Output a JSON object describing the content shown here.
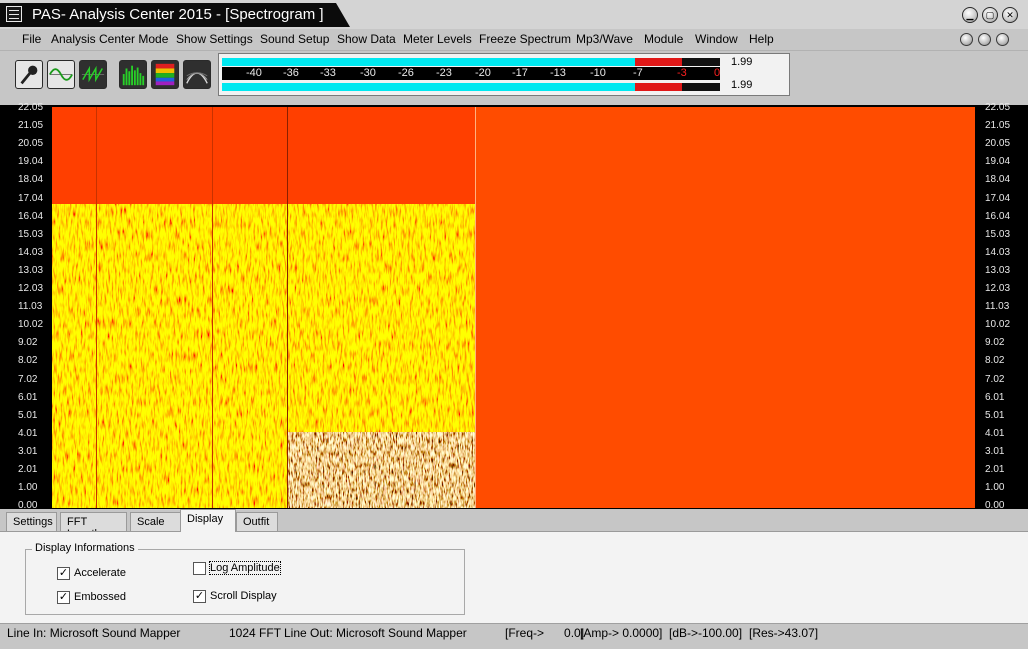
{
  "window": {
    "title": "PAS- Analysis Center 2015 - [Spectrogram ]",
    "icon": "app-window-icon"
  },
  "menu": [
    "File",
    "Analysis Center Mode",
    "Show Settings",
    "Sound Setup",
    "Show Data",
    "Meter Levels",
    "Freeze Spectrum",
    "Mp3/Wave",
    "Module",
    "Window",
    "Help"
  ],
  "toolbar": {
    "buttons": [
      "microphone-icon",
      "sine-wave-icon",
      "sawtooth-wave-icon",
      "spectrum-bars-icon",
      "spectrogram-icon",
      "waterfall-icon"
    ]
  },
  "meter": {
    "scale": [
      "-40",
      "-36",
      "-33",
      "-30",
      "-26",
      "-23",
      "-20",
      "-17",
      "-13",
      "-10",
      "-7",
      "-3",
      "0"
    ],
    "peaks": [
      "1.99",
      "1.99"
    ],
    "colors": {
      "level": "#00e8f0",
      "hot": "#e01818",
      "red_ticks": [
        "-3",
        "0"
      ]
    }
  },
  "spectrogram": {
    "y_axis_labels": [
      "22.05",
      "21.05",
      "20.05",
      "19.04",
      "18.04",
      "17.04",
      "16.04",
      "15.03",
      "14.03",
      "13.03",
      "12.03",
      "11.03",
      "10.02",
      "9.02",
      "8.02",
      "7.02",
      "6.01",
      "5.01",
      "4.01",
      "3.01",
      "2.01",
      "1.00",
      "0.00"
    ],
    "colors": {
      "background": "#ff4c00",
      "texture_hi": "#ffd200",
      "texture_lo": "#c83200"
    }
  },
  "tabs": {
    "items": [
      "Settings",
      "FFT Length",
      "Scale",
      "Display",
      "Outfit"
    ],
    "active": "Display"
  },
  "display_panel": {
    "group_title": "Display Informations",
    "options": {
      "accelerate": {
        "label": "Accelerate",
        "checked": true
      },
      "embossed": {
        "label": "Embossed",
        "checked": true
      },
      "log_amplitude": {
        "label": "Log Amplitude",
        "checked": false
      },
      "scroll_display": {
        "label": "Scroll Display",
        "checked": true
      }
    }
  },
  "status": {
    "line_in": "Line In: Microsoft Sound Mapper",
    "fft": "1024 FFT",
    "line_out": "Line Out: Microsoft Sound Mapper",
    "freq": "[Freq->      0.0]",
    "amp": "[Amp-> 0.0000]",
    "db": "[dB->-100.00]",
    "res": "[Res->43.07]"
  }
}
